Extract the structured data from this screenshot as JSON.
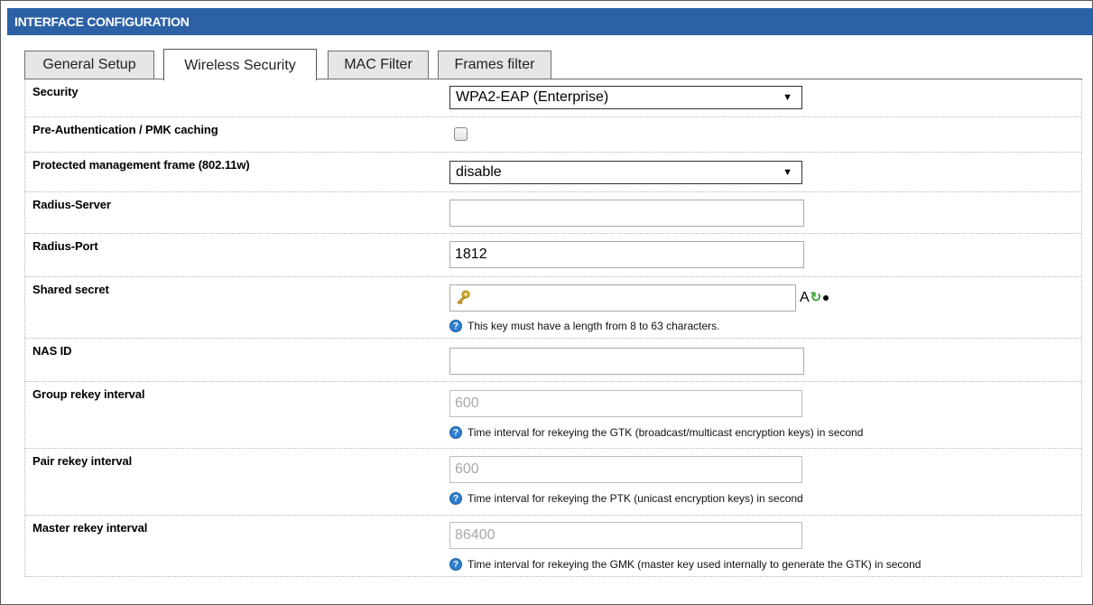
{
  "title": "INTERFACE CONFIGURATION",
  "tabs": [
    "General Setup",
    "Wireless Security",
    "MAC Filter",
    "Frames filter"
  ],
  "active_tab": "Wireless Security",
  "fields": {
    "security": {
      "label": "Security",
      "value": "WPA2-EAP (Enterprise)"
    },
    "preauth": {
      "label": "Pre-Authentication / PMK caching",
      "checked": false
    },
    "pmf": {
      "label": "Protected management frame (802.11w)",
      "value": "disable"
    },
    "radius_server": {
      "label": "Radius-Server",
      "value": ""
    },
    "radius_port": {
      "label": "Radius-Port",
      "value": "1812"
    },
    "shared_secret": {
      "label": "Shared secret",
      "value": "",
      "help": "This key must have a length from 8 to 63 characters.",
      "tool_text": "A"
    },
    "nas_id": {
      "label": "NAS ID",
      "value": ""
    },
    "group_rekey": {
      "label": "Group rekey interval",
      "value": "600",
      "help": "Time interval for rekeying the GTK (broadcast/multicast encryption keys) in second"
    },
    "pair_rekey": {
      "label": "Pair rekey interval",
      "value": "600",
      "help": "Time interval for rekeying the PTK (unicast encryption keys) in second"
    },
    "master_rekey": {
      "label": "Master rekey interval",
      "value": "86400",
      "help": "Time interval for rekeying the GMK (master key used internally to generate the GTK) in second"
    }
  },
  "colors": {
    "title_bar": "#2c61a6",
    "help_icon": "#2d7fd0",
    "refresh_icon": "#3aa23a"
  },
  "icons": {
    "help": "question-circle-icon",
    "key": "key-icon",
    "refresh": "refresh-icon",
    "dropdown": "triangle-down-icon"
  }
}
